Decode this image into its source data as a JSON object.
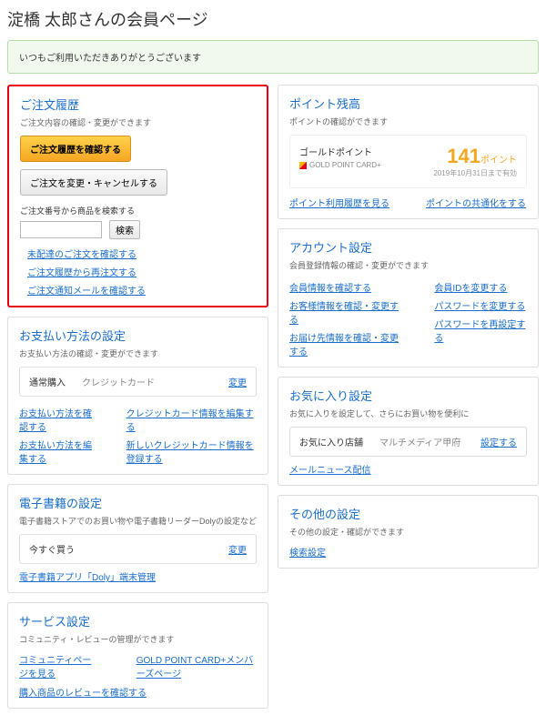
{
  "page_title": "淀橋 太郎さんの会員ページ",
  "notice": "いつもご利用いただきありがとうございます",
  "left": {
    "order": {
      "title": "ご注文履歴",
      "desc": "ご注文内容の確認・変更ができます",
      "btn_confirm": "ご注文履歴を確認する",
      "btn_cancel": "ご注文を変更・キャンセルする",
      "search_label": "ご注文番号から商品を検索する",
      "search_btn": "検索",
      "links": [
        "未配達のご注文を確認する",
        "ご注文履歴から再注文する",
        "ご注文通知メールを確認する"
      ]
    },
    "payment": {
      "title": "お支払い方法の設定",
      "desc": "お支払い方法の確認・変更ができます",
      "box_label": "通常購入",
      "box_val": "クレジットカード",
      "change": "変更",
      "links_a": [
        "お支払い方法を確認する",
        "お支払い方法を編集する"
      ],
      "links_b": [
        "クレジットカード情報を編集する",
        "新しいクレジットカード情報を登録する"
      ]
    },
    "ebook": {
      "title": "電子書籍の設定",
      "desc": "電子書籍ストアでのお買い物や電子書籍リーダーDolyの設定など",
      "box_label": "今すぐ買う",
      "change": "変更",
      "link": "電子書籍アプリ「Doly」端末管理"
    },
    "service": {
      "title": "サービス設定",
      "desc": "コミュニティ・レビューの管理ができます",
      "links": [
        "コミュニティページを見る",
        "GOLD POINT CARD+メンバーズページ"
      ],
      "link2": "購入商品のレビューを確認する"
    }
  },
  "right": {
    "points": {
      "title": "ポイント残高",
      "desc": "ポイントの確認ができます",
      "gold_label": "ゴールドポイント",
      "card_label": "GOLD POINT CARD+",
      "num": "141",
      "unit": "ポイント",
      "date": "2019年10月31日まで有効",
      "links": [
        "ポイント利用履歴を見る",
        "ポイントの共通化をする"
      ]
    },
    "account": {
      "title": "アカウント設定",
      "desc": "会員登録情報の確認・変更ができます",
      "links_a": [
        "会員情報を確認する",
        "お客様情報を確認・変更する",
        "お届け先情報を確認・変更する"
      ],
      "links_b": [
        "会員IDを変更する",
        "パスワードを変更する",
        "パスワードを再設定する"
      ]
    },
    "fav": {
      "title": "お気に入り設定",
      "desc": "お気に入りを設定して、さらにお買い物を便利に",
      "box_label": "お気に入り店舗",
      "box_val": "マルチメディア甲府",
      "set": "設定する",
      "link": "メールニュース配信"
    },
    "other": {
      "title": "その他の設定",
      "desc": "その他の設定・確認ができます",
      "link": "検索設定"
    }
  }
}
